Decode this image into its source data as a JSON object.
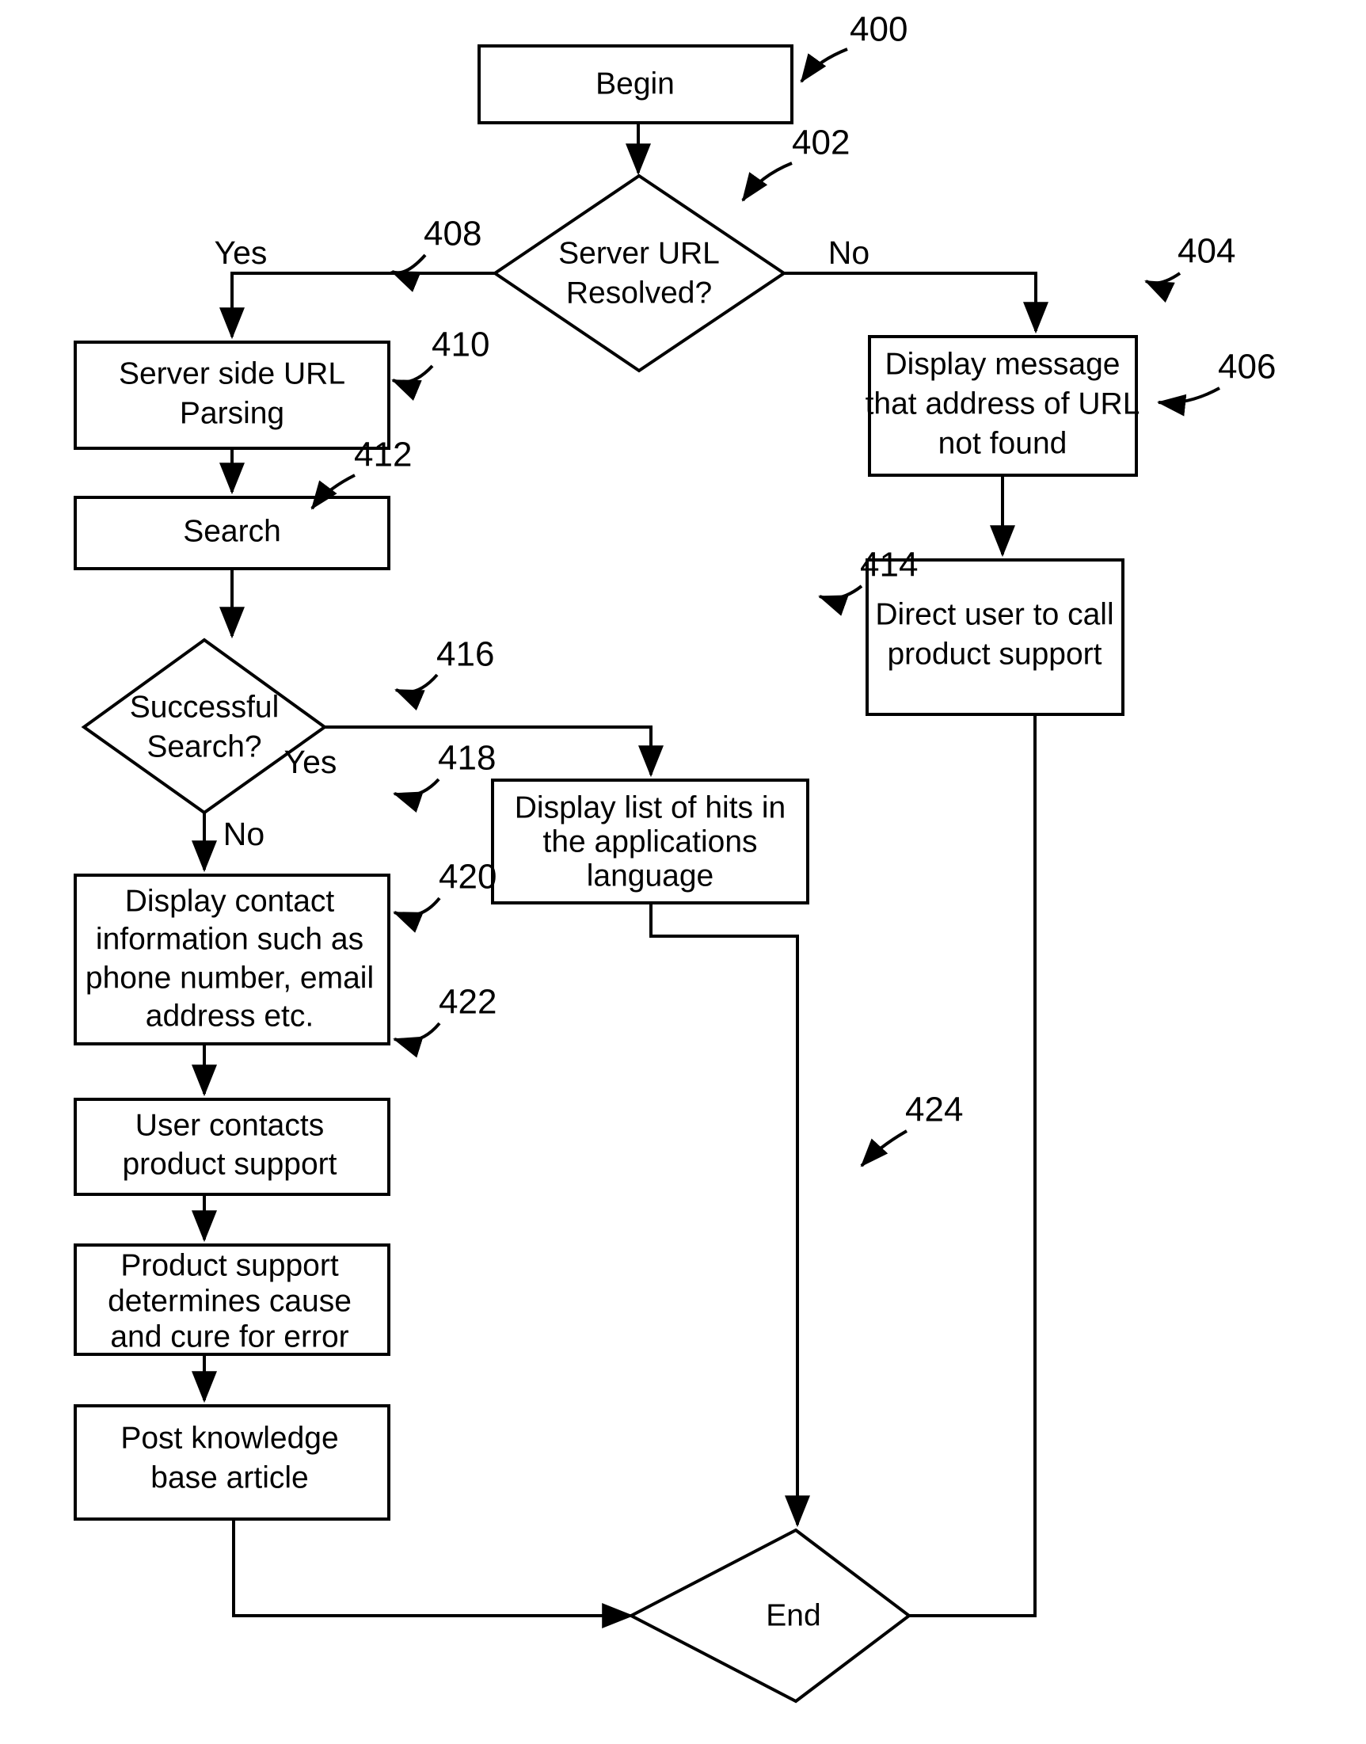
{
  "figure": {
    "type": "flowchart",
    "title": "",
    "nodes": [
      {
        "ref": "400",
        "shape": "process",
        "lines": [
          "Begin"
        ]
      },
      {
        "ref": "402",
        "shape": "decision",
        "lines": [
          "Server URL",
          "Resolved?"
        ]
      },
      {
        "ref": "404",
        "shape": "process",
        "lines": [
          "Display message",
          "that address of URL",
          "not found"
        ]
      },
      {
        "ref": "406",
        "shape": "process",
        "lines": [
          "Direct user to call",
          "product support"
        ]
      },
      {
        "ref": "408",
        "shape": "process",
        "lines": [
          "Server side URL",
          "Parsing"
        ]
      },
      {
        "ref": "410",
        "shape": "process",
        "lines": [
          "Search"
        ]
      },
      {
        "ref": "412",
        "shape": "decision",
        "lines": [
          "Successful",
          "Search?"
        ]
      },
      {
        "ref": "414",
        "shape": "process",
        "lines": [
          "Display list of hits in",
          "the applications",
          "language"
        ]
      },
      {
        "ref": "416",
        "shape": "process",
        "lines": [
          "Display contact",
          "information such as",
          "phone number, email",
          "address etc."
        ]
      },
      {
        "ref": "418",
        "shape": "process",
        "lines": [
          "User contacts",
          "product support"
        ]
      },
      {
        "ref": "420",
        "shape": "process",
        "lines": [
          "Product support",
          "determines cause",
          "and cure for error"
        ]
      },
      {
        "ref": "422",
        "shape": "process",
        "lines": [
          "Post knowledge",
          "base article"
        ]
      },
      {
        "ref": "424",
        "shape": "decision",
        "lines": [
          "End"
        ]
      }
    ],
    "branch_labels": {
      "resolved_yes": "Yes",
      "resolved_no": "No",
      "search_yes": "Yes",
      "search_no": "No"
    },
    "text": {
      "begin": "Begin",
      "server_url_resolved_l1": "Server URL",
      "server_url_resolved_l2": "Resolved?",
      "display_msg_l1": "Display message",
      "display_msg_l2": "that address of URL",
      "display_msg_l3": "not found",
      "direct_user_l1": "Direct user to call",
      "direct_user_l2": "product support",
      "server_side_l1": "Server side URL",
      "server_side_l2": "Parsing",
      "search": "Search",
      "successful_search_l1": "Successful",
      "successful_search_l2": "Search?",
      "display_hits_l1": "Display list of hits in",
      "display_hits_l2": "the applications",
      "display_hits_l3": "language",
      "display_contact_l1": "Display contact",
      "display_contact_l2": "information such as",
      "display_contact_l3": "phone number, email",
      "display_contact_l4": "address etc.",
      "user_contacts_l1": "User contacts",
      "user_contacts_l2": "product support",
      "product_support_l1": "Product support",
      "product_support_l2": "determines cause",
      "product_support_l3": "and cure for error",
      "post_kb_l1": "Post knowledge",
      "post_kb_l2": "base article",
      "end": "End"
    },
    "refs": {
      "r400": "400",
      "r402": "402",
      "r404": "404",
      "r406": "406",
      "r408": "408",
      "r410": "410",
      "r412": "412",
      "r414": "414",
      "r416": "416",
      "r418": "418",
      "r420": "420",
      "r422": "422",
      "r424": "424"
    },
    "colors": {
      "stroke": "#000000",
      "fill": "#ffffff",
      "background": "#ffffff"
    }
  }
}
